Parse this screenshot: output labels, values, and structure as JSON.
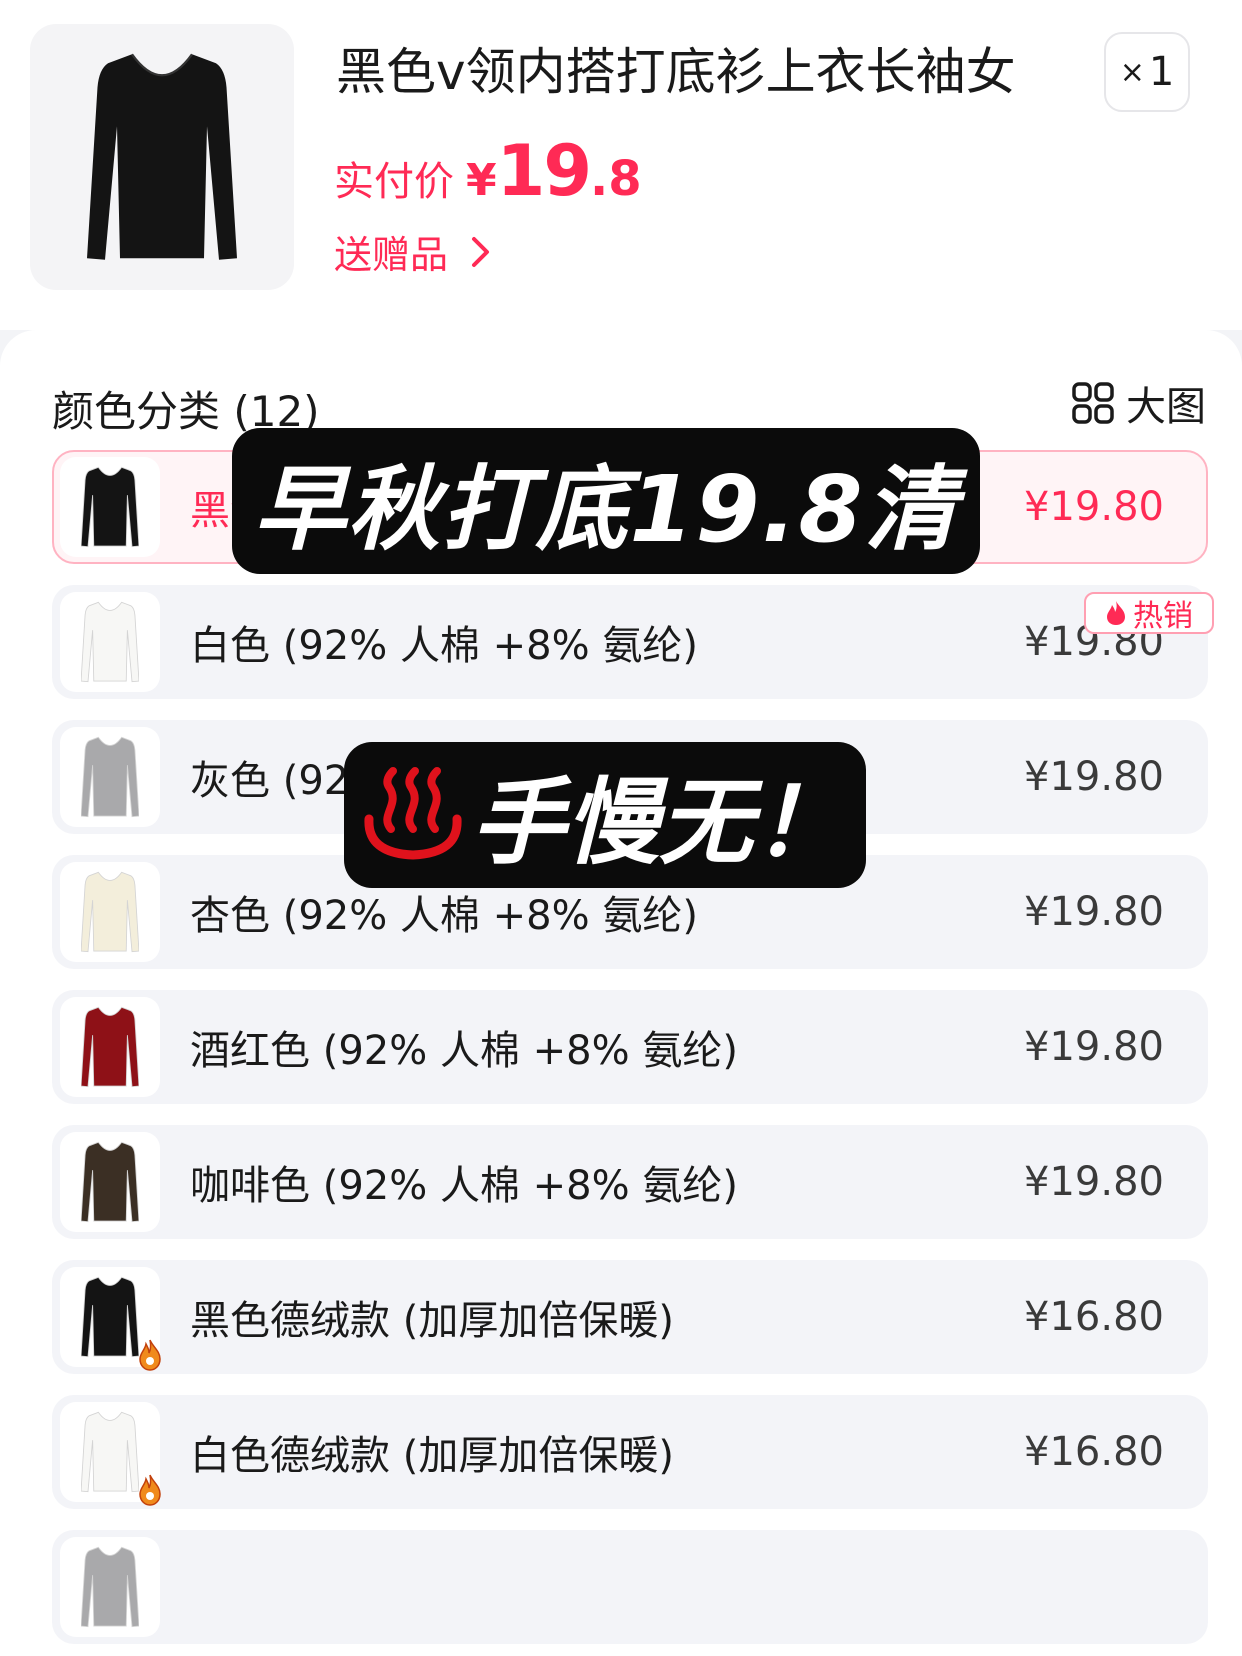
{
  "product": {
    "title": "黑色v领内搭打底衫上衣长袖女",
    "quantity_prefix": "×",
    "quantity": "1",
    "price_label": "实付价",
    "price_currency": "¥",
    "price_integer": "19",
    "price_decimal": ".8",
    "gift_label": "送赠品"
  },
  "section": {
    "title": "颜色分类 (12)",
    "view_toggle_label": "大图"
  },
  "hot_tag": "热销",
  "overlay": {
    "caption_top": "早秋打底19.8清",
    "caption_bottom": "手慢无！"
  },
  "colors": {
    "selected_accent": "#ff2a55",
    "item_bg": "#f3f4f8"
  },
  "options": [
    {
      "label": "黑色 (92% 人棉 +8% 氨纶)",
      "price": "¥19.80",
      "shirt_color": "#141414",
      "selected": true,
      "flame": false
    },
    {
      "label": "白色 (92% 人棉 +8% 氨纶)",
      "price": "¥19.80",
      "shirt_color": "#f7f7f5",
      "selected": false,
      "flame": false
    },
    {
      "label": "灰色 (92% 人棉 +8% 氨纶)",
      "price": "¥19.80",
      "shirt_color": "#a9a9ab",
      "selected": false,
      "flame": false
    },
    {
      "label": "杏色 (92% 人棉 +8% 氨纶)",
      "price": "¥19.80",
      "shirt_color": "#f3eedb",
      "selected": false,
      "flame": false
    },
    {
      "label": "酒红色 (92% 人棉 +8% 氨纶)",
      "price": "¥19.80",
      "shirt_color": "#8e1117",
      "selected": false,
      "flame": false
    },
    {
      "label": "咖啡色 (92% 人棉 +8% 氨纶)",
      "price": "¥19.80",
      "shirt_color": "#3b2f24",
      "selected": false,
      "flame": false
    },
    {
      "label": "黑色德绒款 (加厚加倍保暖)",
      "price": "¥16.80",
      "shirt_color": "#141414",
      "selected": false,
      "flame": true
    },
    {
      "label": "白色德绒款 (加厚加倍保暖)",
      "price": "¥16.80",
      "shirt_color": "#f7f7f5",
      "selected": false,
      "flame": true
    },
    {
      "label": "",
      "price": "",
      "shirt_color": "#a9a9ab",
      "selected": false,
      "flame": false
    }
  ]
}
